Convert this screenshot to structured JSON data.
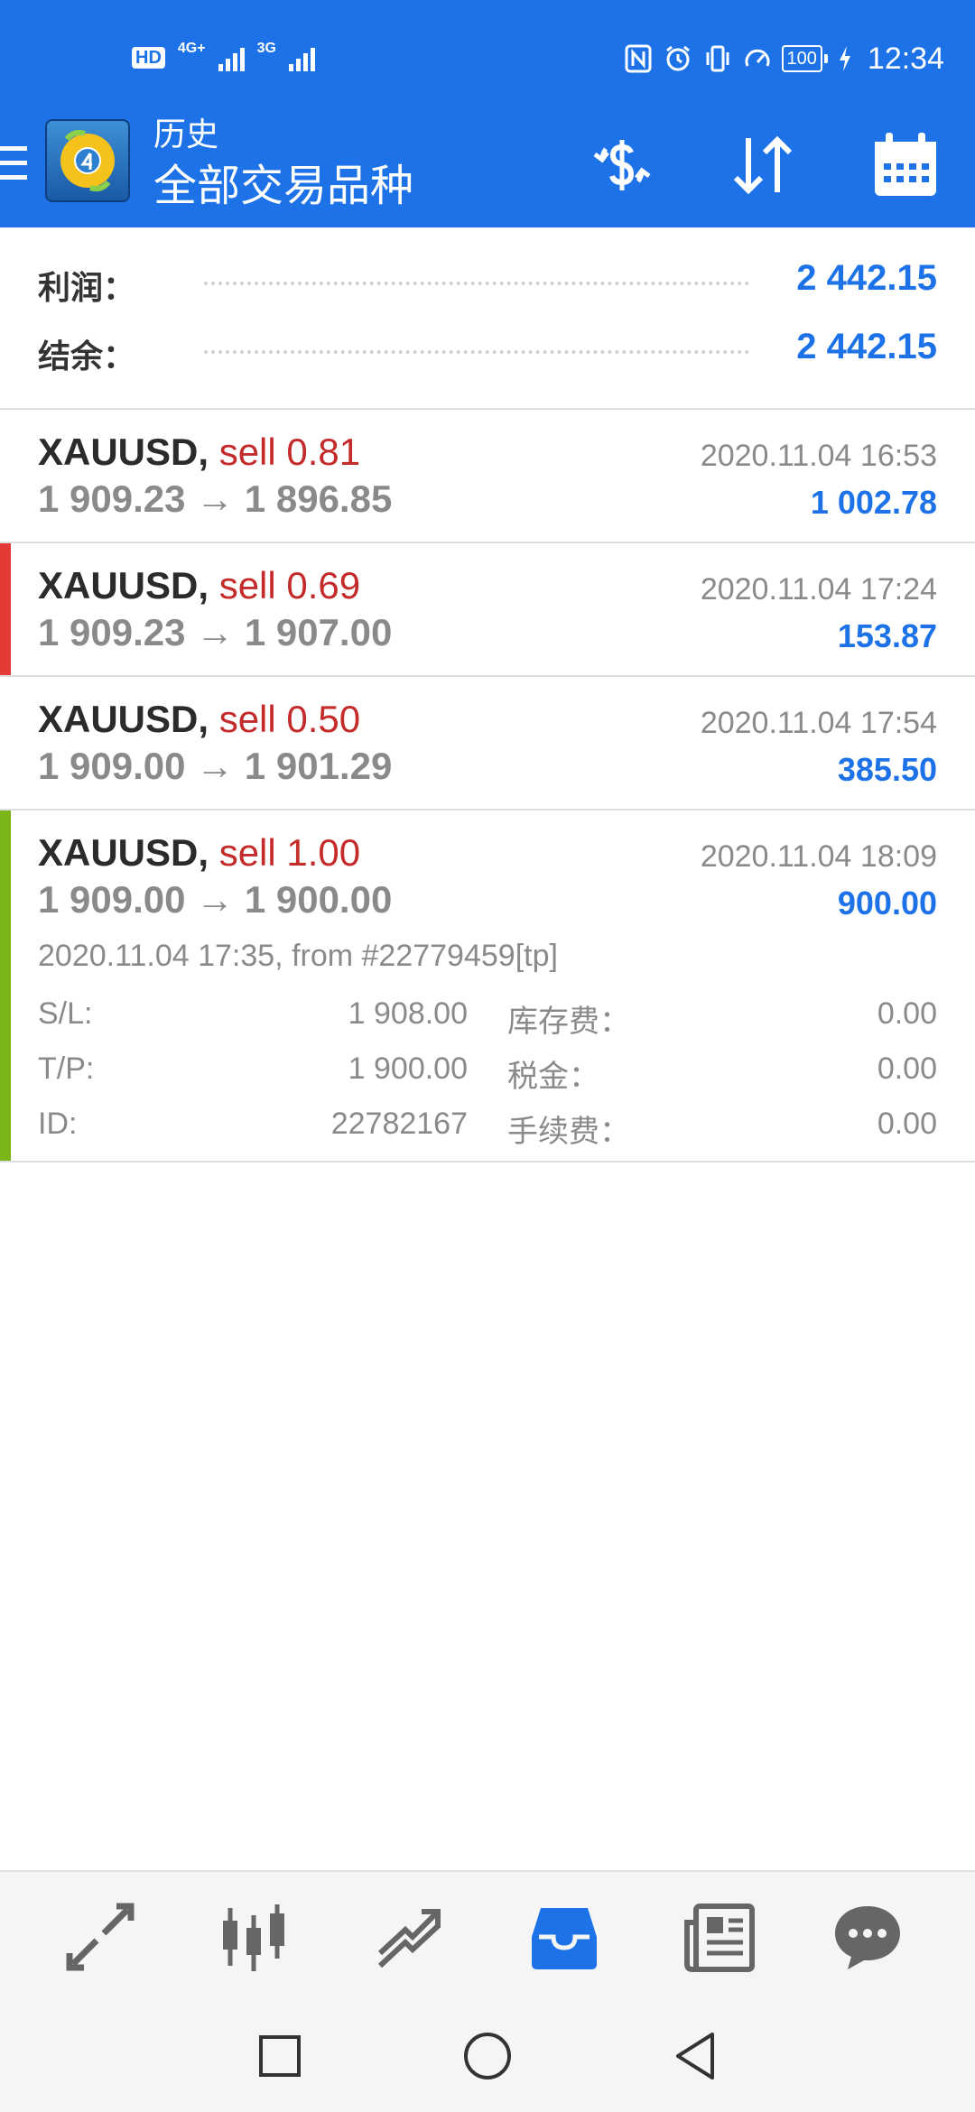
{
  "status_bar": {
    "left_badge": "HD",
    "sim1_network": "4G+",
    "sim2_network": "3G",
    "battery": "100",
    "time": "12:34",
    "icons": [
      "nfc-icon",
      "alarm-icon",
      "vibrate-icon",
      "data-saver-icon",
      "battery-icon",
      "charging-icon"
    ]
  },
  "app_bar": {
    "title_small": "历史",
    "title_big": "全部交易品种",
    "actions": [
      "currency-exchange-icon",
      "sort-icon",
      "calendar-icon"
    ]
  },
  "summary": {
    "profit_label": "利润：",
    "profit_value": "2 442.15",
    "balance_label": "结余：",
    "balance_value": "2 442.15"
  },
  "trades": [
    {
      "symbol": "XAUUSD,",
      "side": "sell 0.81",
      "prices": "1 909.23 → 1 896.85",
      "time": "2020.11.04 16:53",
      "profit": "1 002.78",
      "accent": null
    },
    {
      "symbol": "XAUUSD,",
      "side": "sell 0.69",
      "prices": "1 909.23 → 1 907.00",
      "time": "2020.11.04 17:24",
      "profit": "153.87",
      "accent": "#e53935"
    },
    {
      "symbol": "XAUUSD,",
      "side": "sell 0.50",
      "prices": "1 909.00 → 1 901.29",
      "time": "2020.11.04 17:54",
      "profit": "385.50",
      "accent": null
    },
    {
      "symbol": "XAUUSD,",
      "side": "sell 1.00",
      "prices": "1 909.00 → 1 900.00",
      "time": "2020.11.04 18:09",
      "profit": "900.00",
      "accent": "#7cb518",
      "details": {
        "open_info": "2020.11.04 17:35, from #22779459[tp]",
        "rows": [
          {
            "label": "S/L:",
            "value": "1 908.00",
            "label2": "库存费：",
            "value2": "0.00"
          },
          {
            "label": "T/P:",
            "value": "1 900.00",
            "label2": "税金：",
            "value2": "0.00"
          },
          {
            "label": "ID:",
            "value": "22782167",
            "label2": "手续费：",
            "value2": "0.00"
          }
        ]
      }
    }
  ],
  "tab_bar": {
    "tabs": [
      "quotes-icon",
      "chart-icon",
      "trade-icon",
      "history-icon",
      "news-icon",
      "chat-icon"
    ],
    "active": "history-icon"
  },
  "colors": {
    "brand_blue": "#1d72e8",
    "sell_red": "#c42b2b",
    "accent_red": "#e53935",
    "accent_green": "#7cb518",
    "muted_gray": "#8a8a8a"
  }
}
